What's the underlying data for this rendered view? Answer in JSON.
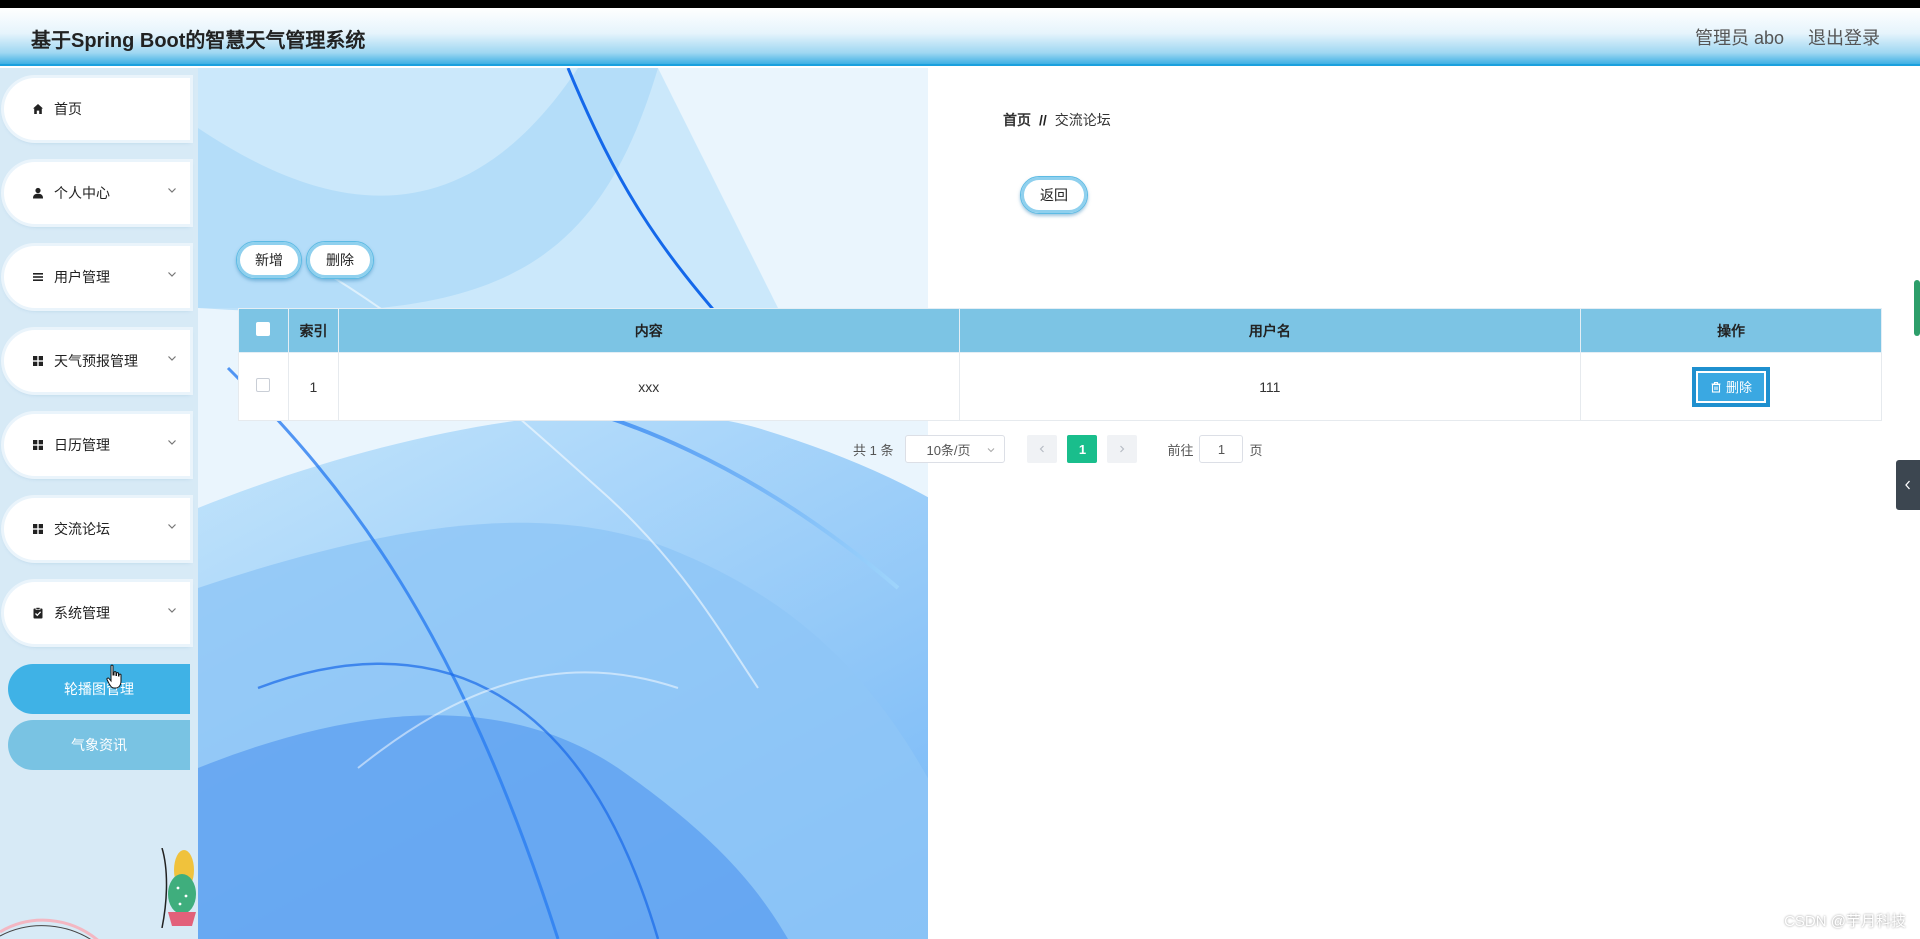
{
  "header": {
    "title": "基于Spring Boot的智慧天气管理系统",
    "user_label": "管理员 abo",
    "logout_label": "退出登录"
  },
  "sidebar": {
    "items": [
      {
        "label": "首页",
        "icon": "home-icon"
      },
      {
        "label": "个人中心",
        "icon": "user-icon"
      },
      {
        "label": "用户管理",
        "icon": "list-icon"
      },
      {
        "label": "天气预报管理",
        "icon": "grid-icon"
      },
      {
        "label": "日历管理",
        "icon": "grid-icon"
      },
      {
        "label": "交流论坛",
        "icon": "grid-icon"
      },
      {
        "label": "系统管理",
        "icon": "clipboard-icon"
      }
    ],
    "sub_items": [
      {
        "label": "轮播图管理",
        "state": "active"
      },
      {
        "label": "气象资讯",
        "state": "normal"
      }
    ]
  },
  "breadcrumb": {
    "home": "首页",
    "separator": "//",
    "current": "交流论坛"
  },
  "buttons": {
    "back": "返回",
    "add": "新增",
    "delete": "删除"
  },
  "table": {
    "columns": [
      "索引",
      "内容",
      "用户名",
      "操作"
    ],
    "rows": [
      {
        "index": "1",
        "content": "xxx",
        "username": "111",
        "action": "删除"
      }
    ]
  },
  "pagination": {
    "total": "共 1 条",
    "page_size": "10条/页",
    "current_page": "1",
    "goto_label": "前往",
    "goto_value": "1",
    "page_suffix": "页"
  },
  "watermark": "CSDN @芋月科技",
  "colors": {
    "header_accent": "#1aa0de",
    "table_header": "#7cc4e4",
    "sub_active": "#3fb2e6",
    "sub_normal": "#79c3e3",
    "delete_button": "#3aa8e2",
    "current_page": "#19be8c"
  }
}
